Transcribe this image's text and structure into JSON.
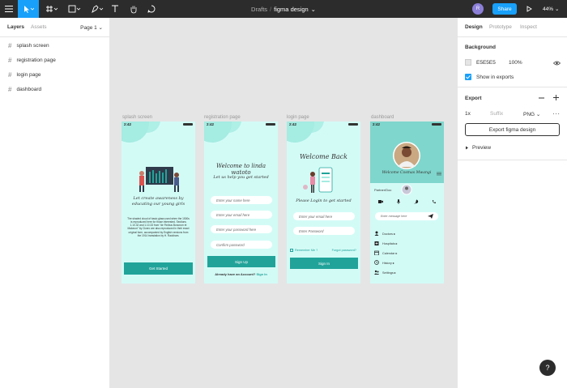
{
  "toolbar": {
    "breadcrumb_parent": "Drafts",
    "breadcrumb_sep": "/",
    "file_name": "figma design",
    "file_chevron": "⌄",
    "avatar_initial": "R",
    "share_label": "Share",
    "zoom_label": "44%",
    "zoom_chevron": "⌄",
    "accent": "#18a0fb"
  },
  "left_panel": {
    "tab_layers": "Layers",
    "tab_assets": "Assets",
    "page_selector": "Page 1 ⌄",
    "layers": [
      {
        "label": "splash screen"
      },
      {
        "label": "registration page"
      },
      {
        "label": "login page"
      },
      {
        "label": "dashboard"
      }
    ]
  },
  "canvas": {
    "frames": [
      {
        "label": "splash screen",
        "time": "2:42",
        "tagline": "Let create awareness by educating our young girls",
        "body": "The shaded cloud of basic glass used when the 1500s is reproduced here for those interested. Sections 1.10.32 and 1.10.33 from \"de Finibus Bonorum et Malorum\" by Cicero are also reproduced in their exact original form, accompanied by English versions from the 1914 translation by H. Rackham.",
        "button": "Get Started"
      },
      {
        "label": "registration page",
        "time": "2:42",
        "title": "Welcome to linda watoto",
        "subtitle": "Let us help you get started",
        "fields": [
          "Enter your name here",
          "Enter your email here",
          "Enter your password here",
          "Confirm password"
        ],
        "button": "Sign Up",
        "footer": "Already have an Account?",
        "footer_link": "Sign In"
      },
      {
        "label": "login page",
        "time": "2:42",
        "title": "Welcome Back",
        "subtitle": "Please Login to get started",
        "fields": [
          "Enter your email here",
          "Enter Password"
        ],
        "remember": "Remember Me ?",
        "forgot": "Forgot password?",
        "button": "Sign In"
      },
      {
        "label": "dashboard",
        "time": "2:42",
        "welcome": "Welcome Cosmas Mwangi",
        "section_label": "Partner/Doc",
        "message_placeholder": "Enter message here",
        "menu": [
          "Doctors ▸",
          "Hospitals ▸",
          "Calendar ▸",
          "History ▸",
          "Settings ▸"
        ]
      }
    ]
  },
  "right_panel": {
    "tab_design": "Design",
    "tab_prototype": "Prototype",
    "tab_inspect": "Inspect",
    "background_title": "Background",
    "bg_hex": "E5E5E5",
    "bg_opacity": "100%",
    "show_in_exports": "Show in exports",
    "export_title": "Export",
    "export_scale": "1x",
    "export_suffix_placeholder": "Suffix",
    "export_format": "PNG ⌄",
    "export_button": "Export figma design",
    "preview": "Preview"
  },
  "help_label": "?"
}
